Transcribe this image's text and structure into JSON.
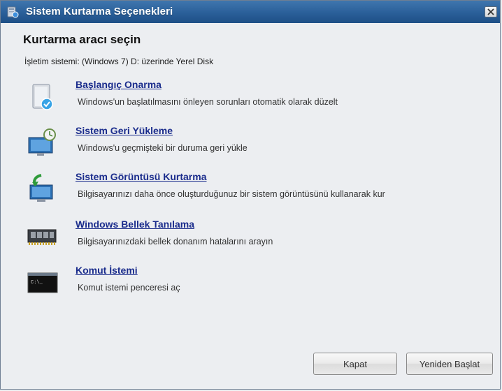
{
  "window": {
    "title": "Sistem Kurtarma Seçenekleri",
    "close_label": "X"
  },
  "main": {
    "heading": "Kurtarma aracı seçin",
    "os_info": "İşletim sistemi: (Windows 7) D: üzerinde Yerel Disk",
    "tools": [
      {
        "label": "Başlangıç Onarma",
        "description": "Windows'un başlatılmasını önleyen sorunları otomatik olarak düzelt",
        "icon": "startup-repair-icon"
      },
      {
        "label": "Sistem Geri Yükleme",
        "description": "Windows'u geçmişteki bir duruma geri yükle",
        "icon": "system-restore-icon"
      },
      {
        "label": "Sistem Görüntüsü Kurtarma",
        "description": "Bilgisayarınızı daha önce oluşturduğunuz bir sistem görüntüsünü kullanarak kur",
        "icon": "system-image-recovery-icon"
      },
      {
        "label": "Windows Bellek Tanılama",
        "description": "Bilgisayarınızdaki bellek donanım hatalarını arayın",
        "icon": "memory-diagnostic-icon"
      },
      {
        "label": "Komut İstemi",
        "description": "Komut istemi penceresi aç",
        "icon": "command-prompt-icon"
      }
    ]
  },
  "footer": {
    "close_button": "Kapat",
    "restart_button": "Yeniden Başlat"
  },
  "colors": {
    "titlebar": "#2a5f99",
    "link": "#1a2c8c",
    "background": "#eceef1"
  }
}
